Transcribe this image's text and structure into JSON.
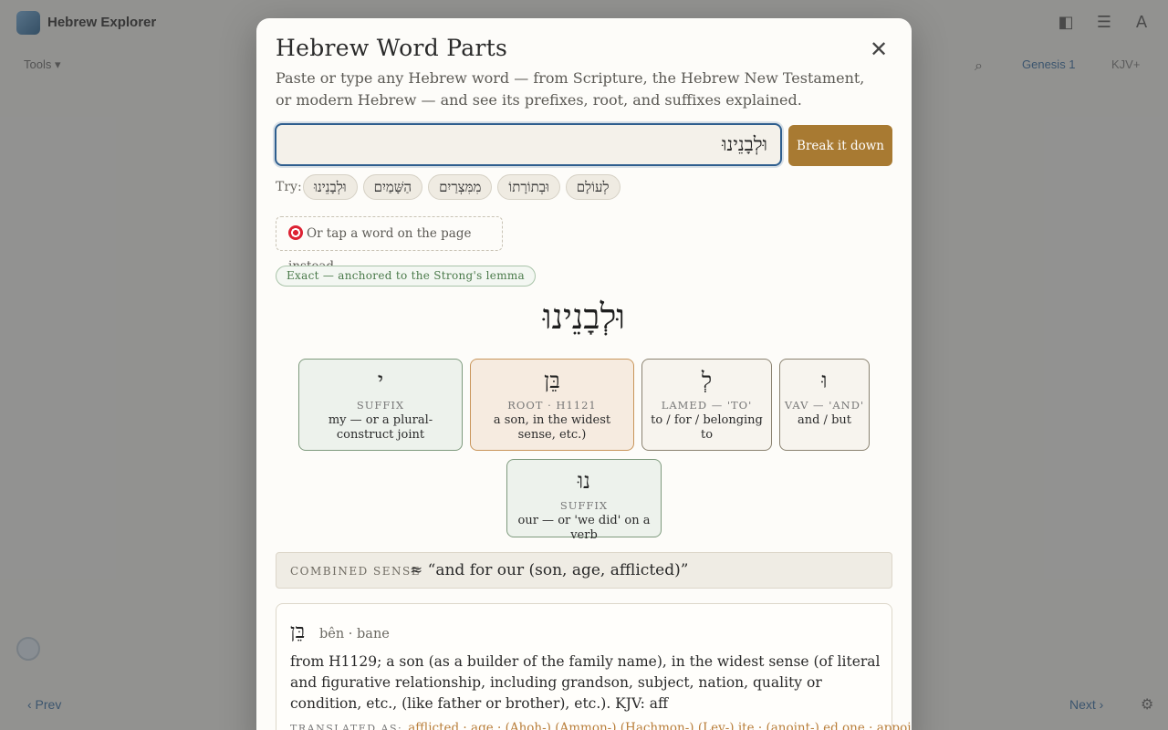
{
  "app": {
    "title": "Hebrew Explorer",
    "tools_label": "Tools ▾",
    "book_label": "Genesis 1",
    "version_label": "KJV+",
    "prev_label": "‹ Prev",
    "next_label": "Next ›"
  },
  "modal": {
    "title": "Hebrew Word Parts",
    "close_glyph": "✕",
    "description": "Paste or type any Hebrew word — from Scripture, the Hebrew New Testament, or modern Hebrew — and see its prefixes, root, and suffixes explained.",
    "input_value": "וּלְבָנֵינוּ",
    "break_button": "Break it down",
    "try_label": "Try:",
    "examples": [
      "וּלְבָנֵינוּ",
      "הַשָּׁמַיִם",
      "מִמִּצְרַיִם",
      "וּבְתוֹרָתוֹ",
      "לְעוֹלָם"
    ],
    "tap_hint": "Or tap a word on the page instead",
    "exact_badge": "Exact — anchored to the Strong's lemma",
    "word": "וּלְבָנֵינוּ"
  },
  "parts": [
    {
      "kind": "prefix",
      "hebrew": "וּ",
      "label": "VAV — 'AND'",
      "gloss": "and / but"
    },
    {
      "kind": "prefix",
      "hebrew": "לְ",
      "label": "LAMED — 'TO'",
      "gloss": "to / for / belonging to"
    },
    {
      "kind": "root",
      "hebrew": "בֵּן",
      "label": "ROOT · H1121",
      "gloss": "a son, in the widest sense, etc.)"
    },
    {
      "kind": "suffix",
      "hebrew": "י",
      "label": "SUFFIX",
      "gloss": "my — or a plural-construct joint"
    },
    {
      "kind": "suffix",
      "hebrew": "נוּ",
      "label": "SUFFIX",
      "gloss": "our — or 'we did' on a verb"
    }
  ],
  "combined": {
    "label": "COMBINED SENSE",
    "value": "≈ “and for our (son, age, afflicted)”"
  },
  "lexicon": {
    "hebrew": "בֵּן",
    "transliteration": "bên · bane",
    "definition": "from H1129; a son (as a builder of the family name), in the widest sense (of literal and figurative relationship, including grandson, subject, nation, quality or condition, etc., (like father or brother), etc.). KJV: aff",
    "translated_label": "TRANSLATED AS:",
    "translated_value": "afflicted · age · (Ahoh-) (Ammon-) (Hachmon-) (Lev-) ite · (anoint-) ed one · appointed"
  }
}
